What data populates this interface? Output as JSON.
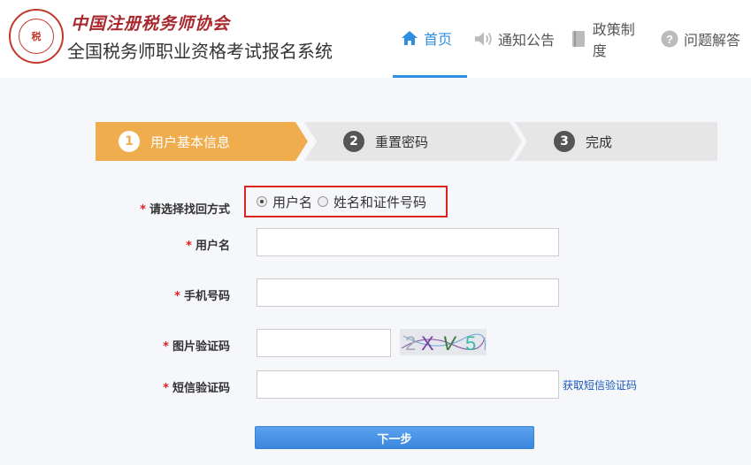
{
  "header": {
    "logo_text": "税",
    "org_name": "中国注册税务师协会",
    "system_title": "全国税务师职业资格考试报名系统"
  },
  "nav": [
    {
      "label": "首页",
      "icon": "home-icon",
      "active": true
    },
    {
      "label": "通知公告",
      "icon": "speaker-icon",
      "active": false
    },
    {
      "label": "政策制度",
      "icon": "book-icon",
      "active": false
    },
    {
      "label": "问题解答",
      "icon": "question-icon",
      "active": false
    }
  ],
  "steps": [
    {
      "num": "1",
      "label": "用户基本信息",
      "active": true
    },
    {
      "num": "2",
      "label": "重置密码",
      "active": false
    },
    {
      "num": "3",
      "label": "完成",
      "active": false
    }
  ],
  "form": {
    "required_mark": "*",
    "recovery_label": "请选择找回方式",
    "recovery_options": [
      "用户名",
      "姓名和证件号码"
    ],
    "recovery_selected": "用户名",
    "username_label": "用户名",
    "username_value": "",
    "phone_label": "手机号码",
    "phone_value": "",
    "image_code_label": "图片验证码",
    "image_code_value": "",
    "captcha_text": "2XV5",
    "sms_code_label": "短信验证码",
    "sms_code_value": "",
    "sms_link": "获取短信验证码",
    "next_button": "下一步"
  },
  "colors": {
    "accent": "#2f8ee0",
    "step_active": "#f0ad4e",
    "step_inactive": "#e6e6e6",
    "highlight_border": "#d9251c",
    "button": "#3b86de"
  }
}
